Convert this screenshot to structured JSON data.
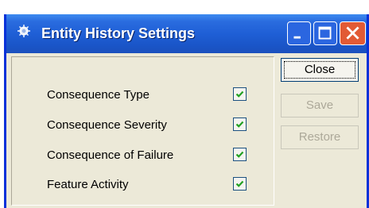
{
  "window": {
    "title": "Entity History Settings",
    "title_color": "#1f5fd6"
  },
  "settings": [
    {
      "label": "Consequence Type",
      "checked": true
    },
    {
      "label": "Consequence Severity",
      "checked": true
    },
    {
      "label": "Consequence of Failure",
      "checked": true
    },
    {
      "label": "Feature Activity",
      "checked": true
    }
  ],
  "buttons": {
    "close_label": "Close",
    "save_label": "Save",
    "restore_label": "Restore"
  },
  "colors": {
    "dialog_bg": "#ece9d8",
    "check_color": "#21a121",
    "disabled_text": "#aca899"
  },
  "icons": [
    "app-icon",
    "minimize-icon",
    "maximize-icon",
    "close-icon",
    "checkmark-icon"
  ]
}
